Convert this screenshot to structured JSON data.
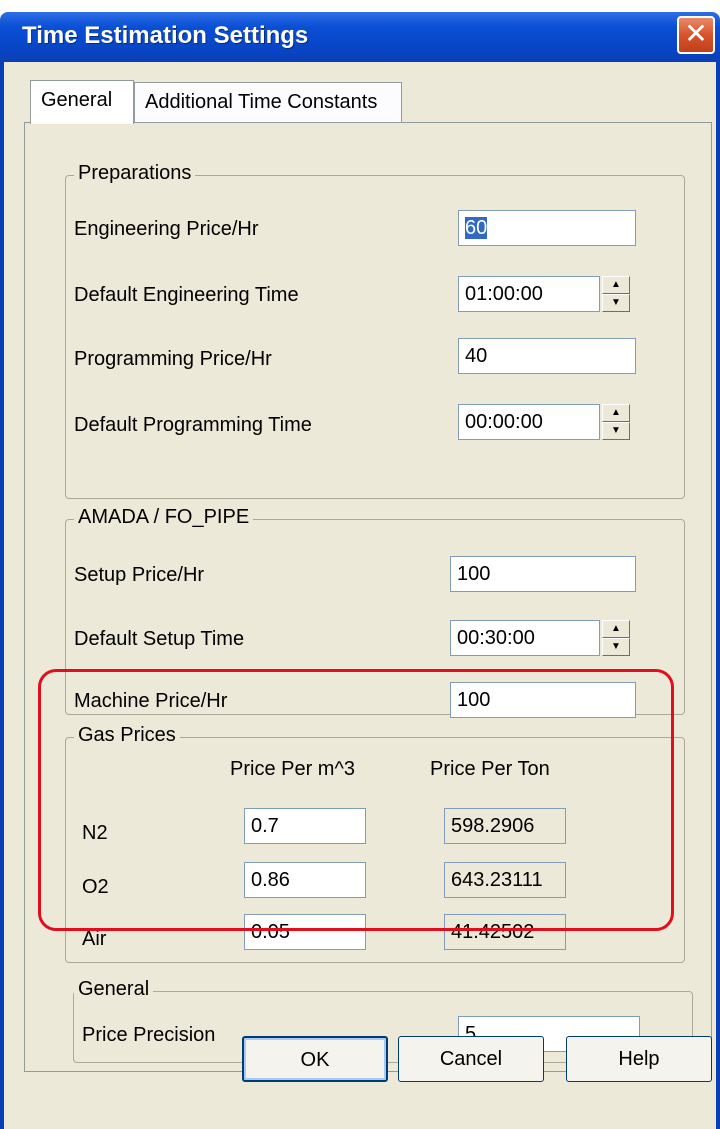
{
  "window": {
    "title": "Time Estimation Settings",
    "close_symbol": "✕"
  },
  "tabs": [
    {
      "label": "General",
      "active": true
    },
    {
      "label": "Additional Time Constants",
      "active": false
    }
  ],
  "preparations": {
    "legend": "Preparations",
    "engineering_price_label": "Engineering Price/Hr",
    "engineering_price_value": "60",
    "default_engineering_time_label": "Default Engineering Time",
    "default_engineering_time_value": "01:00:00",
    "programming_price_label": "Programming Price/Hr",
    "programming_price_value": "40",
    "default_programming_time_label": "Default Programming Time",
    "default_programming_time_value": "00:00:00"
  },
  "amada": {
    "legend": "AMADA / FO_PIPE",
    "setup_price_label": "Setup Price/Hr",
    "setup_price_value": "100",
    "default_setup_time_label": "Default Setup Time",
    "default_setup_time_value": "00:30:00",
    "machine_price_label": "Machine Price/Hr",
    "machine_price_value": "100"
  },
  "gas_prices": {
    "legend": "Gas Prices",
    "col_m3": "Price Per m^3",
    "col_ton": "Price Per Ton",
    "rows": [
      {
        "gas": "N2",
        "per_m3": "0.7",
        "per_ton": "598.2906"
      },
      {
        "gas": "O2",
        "per_m3": "0.86",
        "per_ton": "643.23111"
      },
      {
        "gas": "Air",
        "per_m3": "0.05",
        "per_ton": "41.42502"
      }
    ]
  },
  "general": {
    "legend": "General",
    "price_precision_label": "Price Precision",
    "price_precision_value": "5"
  },
  "buttons": {
    "ok": "OK",
    "cancel": "Cancel",
    "help": "Help"
  },
  "spin_up_symbol": "▲",
  "spin_down_symbol": "▼",
  "colors": {
    "titlebar": "#0846c7",
    "highlight_box": "#e10e1e",
    "dialog_bg": "#ece9d8"
  }
}
